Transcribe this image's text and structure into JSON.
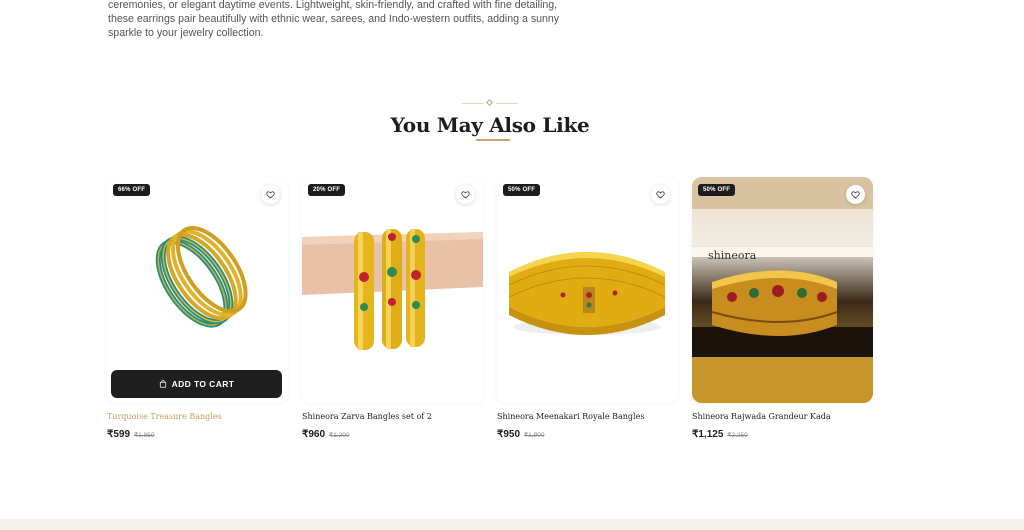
{
  "description": {
    "line1": "ceremonies, or elegant daytime events. Lightweight, skin-friendly, and crafted with fine detailing,",
    "line2": "these earrings pair beautifully with ethnic wear, sarees, and Indo-western outfits, adding a sunny",
    "line3": "sparkle to your jewelry collection."
  },
  "section": {
    "title": "You May Also Like"
  },
  "products": [
    {
      "badge": "66% OFF",
      "name": "Turquoise Treasure Bangles",
      "price": "₹599",
      "mrp": "₹1,850",
      "cta": "ADD TO CART",
      "art": "turquoise-bangles"
    },
    {
      "badge": "20% OFF",
      "name": "Shineora Zarva Bangles set of 2",
      "price": "₹960",
      "mrp": "₹1,200",
      "art": "zarva-bangles-wrist"
    },
    {
      "badge": "50% OFF",
      "name": "Shineora Meenakari Royale Bangles",
      "price": "₹950",
      "mrp": "₹1,900",
      "art": "meenakari-bangles"
    },
    {
      "badge": "50% OFF",
      "name": "Shineora Rajwada Grandeur Kada",
      "price": "₹1,125",
      "mrp": "₹2,250",
      "art": "rajwada-kada",
      "watermark": "shineora"
    }
  ],
  "colors": {
    "accent": "#c39a5d",
    "button": "#1f1f1f",
    "badge": "#1c1c1c"
  }
}
